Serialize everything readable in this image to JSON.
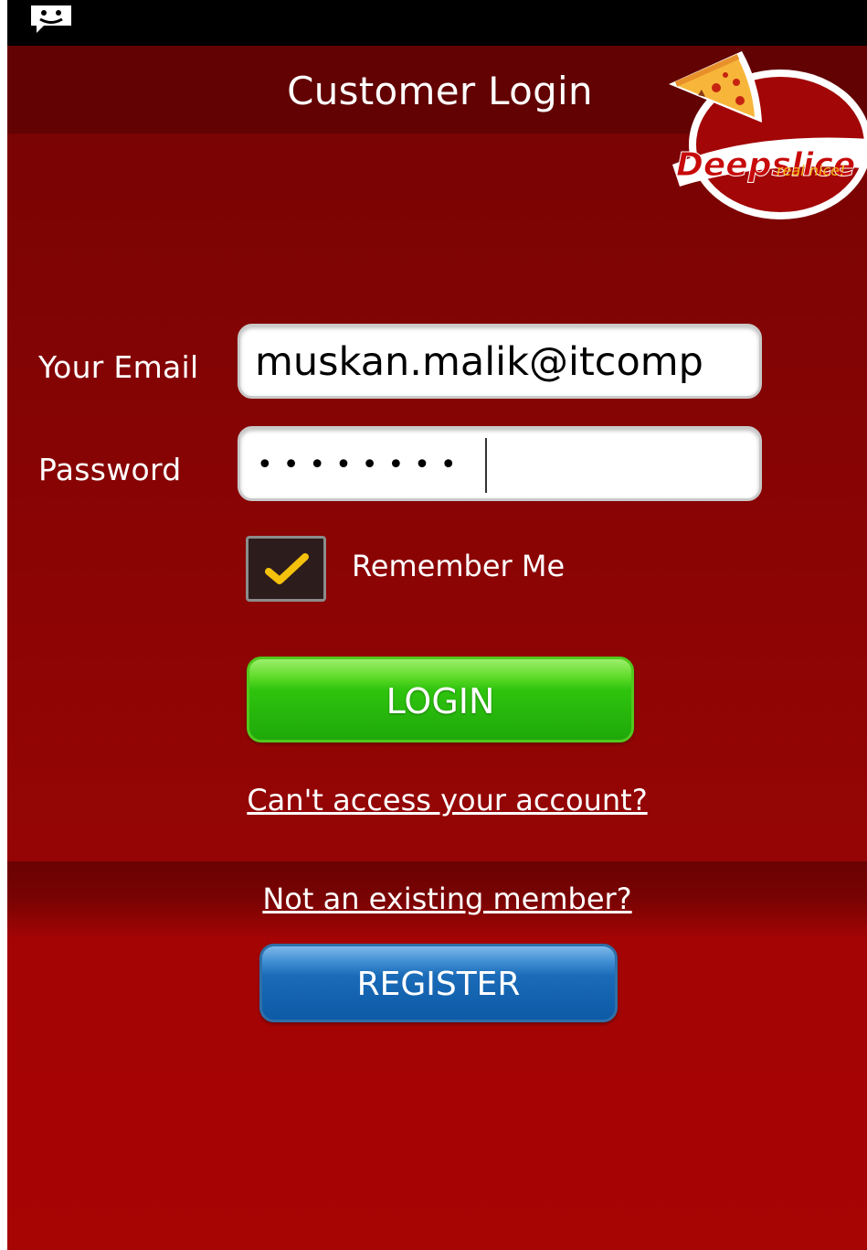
{
  "header": {
    "title": "Customer Login"
  },
  "logo": {
    "brand": "Deepslice",
    "tagline": "real nice!"
  },
  "form": {
    "email_label": "Your Email",
    "email_value": "muskan.malik@itcomp",
    "password_label": "Password",
    "password_mask": "••••••••",
    "remember_label": "Remember Me",
    "remember_checked": true,
    "login_label": "LOGIN",
    "forgot_link": "Can't access your account?"
  },
  "footer": {
    "member_link": "Not an existing member?",
    "register_label": "REGISTER"
  },
  "colors": {
    "background": "#930404",
    "header": "#620202",
    "login_button": "#2fc40e",
    "register_button": "#1a6bb8",
    "checkmark": "#f4c20d"
  }
}
